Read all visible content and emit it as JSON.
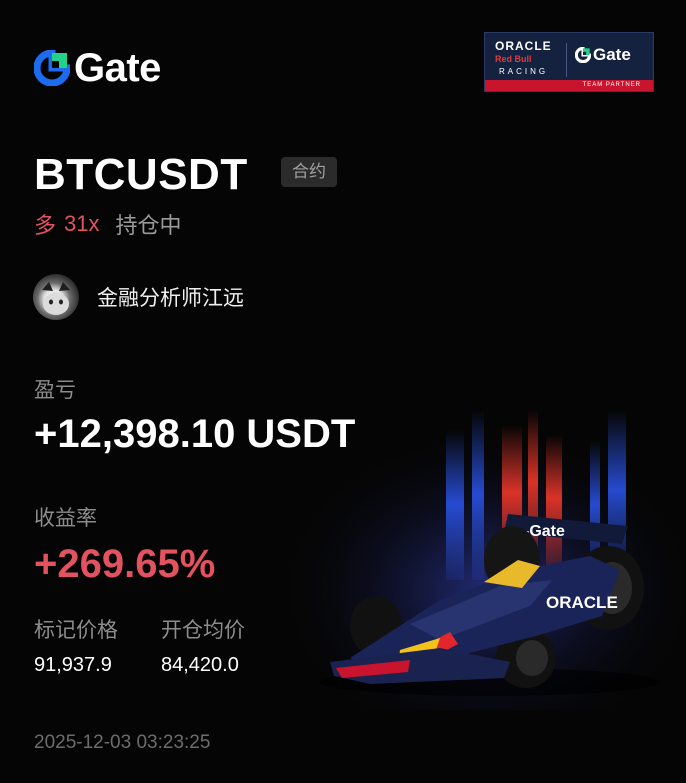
{
  "brand": {
    "logo_text": "Gate",
    "accent_color": "#1d6cf0",
    "accent_green": "#23d18b"
  },
  "partner_banner": {
    "oracle": "ORACLE",
    "red_bull": "Red Bull",
    "racing": "RACING",
    "gate": "Gate",
    "team_partner": "TEAM PARTNER"
  },
  "position": {
    "symbol": "BTCUSDT",
    "type_badge": "合约",
    "side": "多",
    "leverage": "31x",
    "status": "持仓中"
  },
  "user": {
    "name": "金融分析师江远"
  },
  "pnl": {
    "label": "盈亏",
    "value": "+12,398.10 USDT"
  },
  "roi": {
    "label": "收益率",
    "value": "+269.65%"
  },
  "prices": {
    "mark_label": "标记价格",
    "mark_value": "91,937.9",
    "entry_label": "开仓均价",
    "entry_value": "84,420.0"
  },
  "timestamp": "2025-12-03 03:23:25",
  "colors": {
    "profit": "#e2525f",
    "muted": "#8c8c8c",
    "background": "#050505"
  }
}
